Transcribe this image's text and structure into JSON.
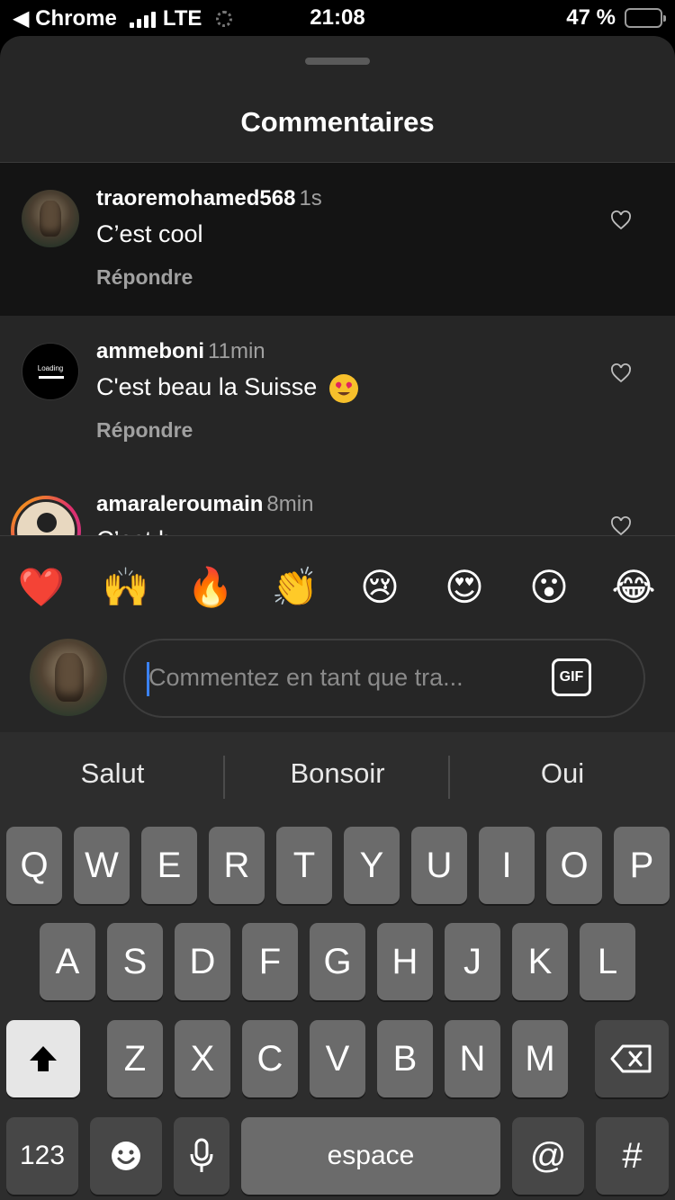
{
  "status_bar": {
    "back_label": "◀ Chrome",
    "network": "LTE",
    "time": "21:08",
    "battery_percent": "47 %",
    "battery_level": 0.47,
    "battery_color": "#f4d03f"
  },
  "sheet": {
    "title": "Commentaires"
  },
  "comments": [
    {
      "username": "traoremohamed568",
      "time": "1s",
      "text": "C’est cool",
      "reply_label": "Répondre",
      "avatar": "groot-avatar"
    },
    {
      "username": "ammeboni",
      "time": "11min",
      "text": "C'est beau la Suisse",
      "emoji": "heart-eyes-emoji",
      "reply_label": "Répondre",
      "avatar": "loading-avatar",
      "avatar_text": "Loading"
    },
    {
      "username": "amaraleroumain",
      "time": "8min",
      "text": "C’est b...",
      "avatar": "story-ring-avatar"
    }
  ],
  "reactions": [
    {
      "name": "red-heart",
      "glyph": "❤️"
    },
    {
      "name": "raising-hands",
      "glyph": "🙌"
    },
    {
      "name": "fire",
      "glyph": "🔥"
    },
    {
      "name": "clapping-hands",
      "glyph": "👏"
    },
    {
      "name": "crying-face",
      "glyph": "😢"
    },
    {
      "name": "heart-eyes",
      "glyph": "😍"
    },
    {
      "name": "surprised-face",
      "glyph": "😮"
    },
    {
      "name": "tears-of-joy",
      "glyph": "😂"
    }
  ],
  "composer": {
    "placeholder": "Commentez en tant que tra...",
    "gif_label": "GIF"
  },
  "keyboard": {
    "suggestions": [
      "Salut",
      "Bonsoir",
      "Oui"
    ],
    "row1": [
      "Q",
      "W",
      "E",
      "R",
      "T",
      "Y",
      "U",
      "I",
      "O",
      "P"
    ],
    "row2": [
      "A",
      "S",
      "D",
      "F",
      "G",
      "H",
      "J",
      "K",
      "L"
    ],
    "row3": [
      "Z",
      "X",
      "C",
      "V",
      "B",
      "N",
      "M"
    ],
    "numbers_label": "123",
    "space_label": "espace",
    "at_label": "@",
    "hash_label": "#"
  }
}
